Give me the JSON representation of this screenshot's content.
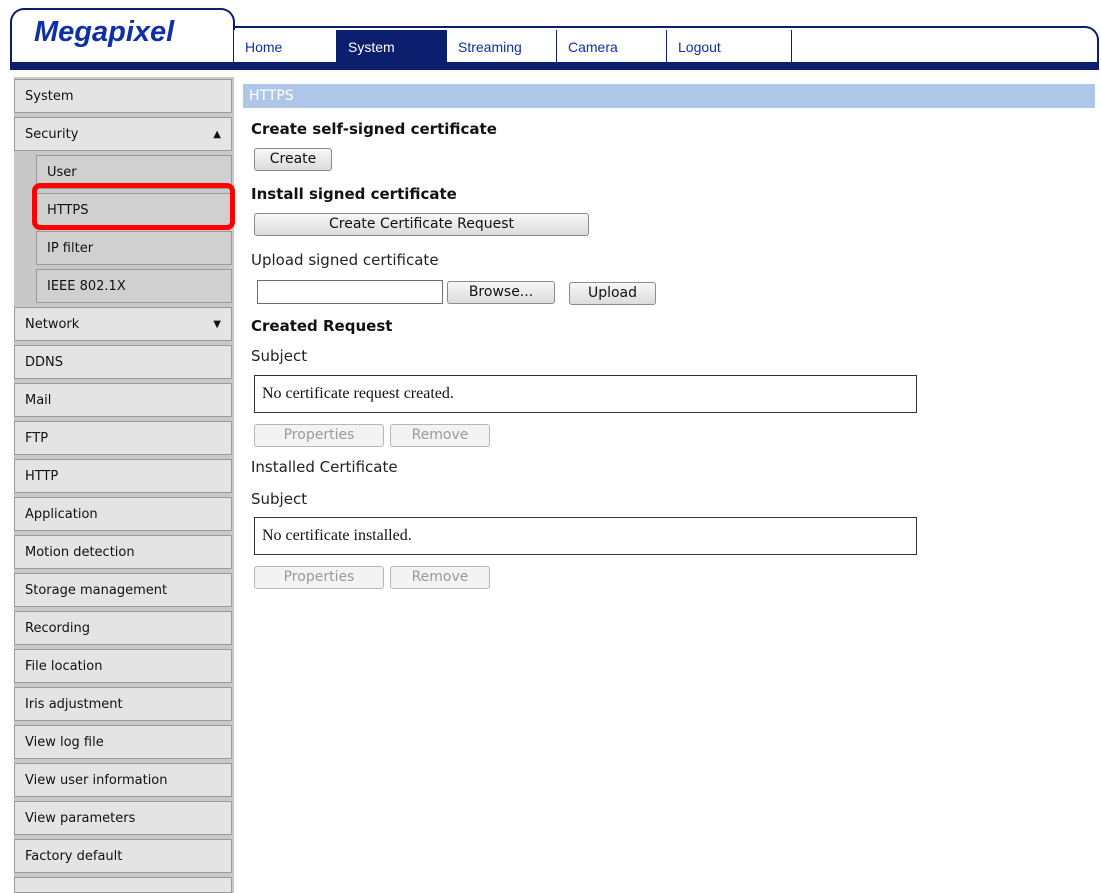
{
  "header": {
    "logo": "Megapixel",
    "tabs": [
      {
        "label": "Home"
      },
      {
        "label": "System"
      },
      {
        "label": "Streaming"
      },
      {
        "label": "Camera"
      },
      {
        "label": "Logout"
      }
    ],
    "active_tab": "System"
  },
  "sidebar": {
    "items": [
      {
        "label": "System"
      },
      {
        "label": "Security"
      },
      {
        "label": "User"
      },
      {
        "label": "HTTPS"
      },
      {
        "label": "IP filter"
      },
      {
        "label": "IEEE 802.1X"
      },
      {
        "label": "Network"
      },
      {
        "label": "DDNS"
      },
      {
        "label": "Mail"
      },
      {
        "label": "FTP"
      },
      {
        "label": "HTTP"
      },
      {
        "label": "Application"
      },
      {
        "label": "Motion detection"
      },
      {
        "label": "Storage management"
      },
      {
        "label": "Recording"
      },
      {
        "label": "File location"
      },
      {
        "label": "Iris adjustment"
      },
      {
        "label": "View log file"
      },
      {
        "label": "View user information"
      },
      {
        "label": "View parameters"
      },
      {
        "label": "Factory default"
      }
    ],
    "selected_item": "HTTPS"
  },
  "content": {
    "title": "HTTPS",
    "create_self_signed_heading": "Create self-signed certificate",
    "create_button": "Create",
    "install_signed_heading": "Install signed certificate",
    "create_request_button": "Create Certificate Request",
    "upload_signed_label": "Upload signed certificate",
    "upload_field_value": "",
    "browse_button": "Browse...",
    "upload_button": "Upload",
    "created_request_heading": "Created Request",
    "subject_label_1": "Subject",
    "request_status": "No certificate request created.",
    "properties_button_1": "Properties",
    "remove_button_1": "Remove",
    "installed_certificate_label": "Installed Certificate",
    "subject_label_2": "Subject",
    "installed_status": "No certificate installed.",
    "properties_button_2": "Properties",
    "remove_button_2": "Remove"
  },
  "colors": {
    "nav_dark": "#0b1f6e",
    "logo_blue": "#0e2fa5",
    "title_bar": "#aec7e8",
    "highlight": "#ff0000"
  }
}
